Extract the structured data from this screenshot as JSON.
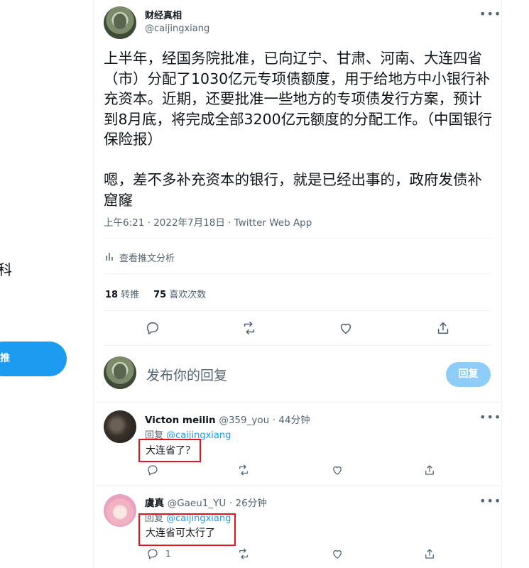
{
  "sidebar": {
    "partial_glyph": "科",
    "tweet_button": "推"
  },
  "tweet": {
    "author_name": "财经真相",
    "author_handle": "@caijingxiang",
    "text": "上半年，经国务院批准，已向辽宁、甘肃、河南、大连四省（市）分配了1030亿元专项债额度，用于给地方中小银行补充资本。近期，还要批准一些地方的专项债发行方案，预计到8月底，将完成全部3200亿元额度的分配工作。（中国银行保险报）\n\n嗯，差不多补充资本的银行，就是已经出事的，政府发债补窟窿",
    "timestamp": "上午6:21 · 2022年7月18日 · Twitter Web App",
    "analytics_label": "查看推文分析",
    "retweets_count": "18",
    "retweets_label": "转推",
    "quotes_count": "75",
    "quotes_label": "喜欢次数",
    "more_icon": "more-icon"
  },
  "compose": {
    "placeholder": "发布你的回复",
    "reply_button": "回复"
  },
  "replies": [
    {
      "name": "Victon meilin",
      "handle": "@359_you",
      "time": "· 44分钟",
      "reply_to_prefix": "回复",
      "reply_to": "@caijingxiang",
      "text": "大连省了？",
      "reply_count": ""
    },
    {
      "name": "虞真",
      "handle": "@Gaeu1_YU",
      "time": "· 26分钟",
      "reply_to_prefix": "回复",
      "reply_to": "@caijingxiang",
      "text": "大连省可太行了",
      "reply_count": "1"
    }
  ],
  "colors": {
    "accent": "#1d9bf0",
    "highlight_box": "#e0161e",
    "muted": "#536471"
  }
}
